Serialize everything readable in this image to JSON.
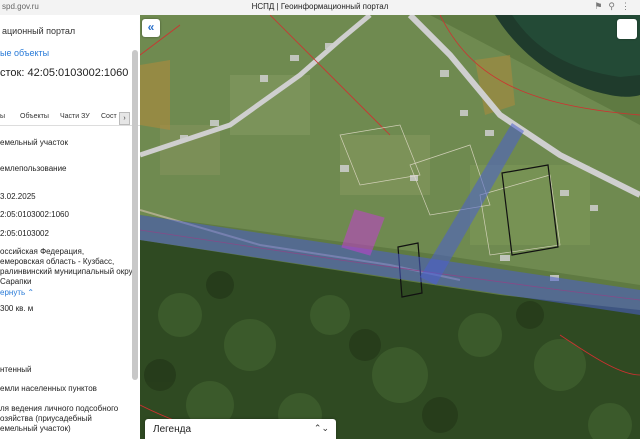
{
  "browser": {
    "url": "spd.gov.ru",
    "title": "НСПД | Геоинформационный портал",
    "icons": [
      "bookmark-icon",
      "pin-icon",
      "info-icon"
    ]
  },
  "panel": {
    "portal_title": "ационный портал",
    "link_objects": "ые объекты",
    "cadastral_label": "сток: 42:05:0103002:1060",
    "tabs": [
      "ы",
      "Объекты",
      "Части ЗУ",
      "Сост"
    ],
    "tab_more": "›",
    "fields": [
      "емельный участок",
      "емлепользование",
      "3.02.2025",
      "2:05:0103002:1060",
      "2:05:0103002",
      "оссийская Федерация,",
      "емеровская область - Кузбасс,",
      "ралинвинский муниципальный округ,",
      "Сарапки",
      "300 кв. м",
      "нтенный",
      "емли населенных пунктов",
      "ля ведения личного подсобного",
      "озяйства (приусадебный",
      "емельный участок)"
    ],
    "collapse_link": "ернуть"
  },
  "map": {
    "collapse_button": "«",
    "legend_label": "Легенда",
    "legend_chevron": "⌃⌄",
    "colors": {
      "forest": "#2f4a22",
      "field": "#6e8a4c",
      "road": "#cfcfcf",
      "river": "#1c3a30",
      "corridor": "#4a5fd0",
      "parcel_highlight": "#c43fd0",
      "boundary_red": "#d03030"
    }
  }
}
